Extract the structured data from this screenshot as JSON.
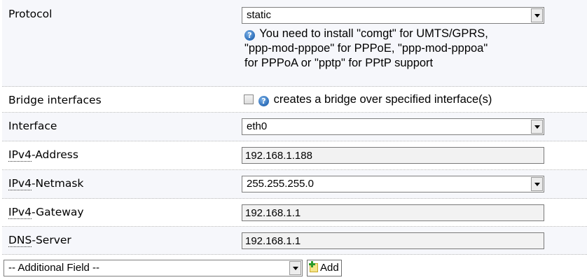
{
  "protocol": {
    "label": "Protocol",
    "selected": "static",
    "help_lines": [
      "You need to install \"comgt\" for UMTS/GPRS,",
      "\"ppp-mod-pppoe\" for PPPoE, \"ppp-mod-pppoa\"",
      "for PPPoA or \"pptp\" for PPtP support"
    ]
  },
  "bridge": {
    "label": "Bridge interfaces",
    "help": "creates a bridge over specified interface(s)"
  },
  "interface": {
    "label": "Interface",
    "selected": "eth0"
  },
  "ipv4_address": {
    "abbr": "IPv4",
    "rest": "-Address",
    "value": "192.168.1.188"
  },
  "ipv4_netmask": {
    "abbr": "IPv4",
    "rest": "-Netmask",
    "selected": "255.255.255.0"
  },
  "ipv4_gateway": {
    "abbr": "IPv4",
    "rest": "-Gateway",
    "value": "192.168.1.1"
  },
  "dns_server": {
    "abbr": "DNS",
    "rest": "-Server",
    "value": "192.168.1.1"
  },
  "additional": {
    "selected": "-- Additional Field --",
    "add_label": "Add"
  },
  "icons": {
    "help": "question-mark-icon",
    "add": "add-document-icon"
  },
  "colors": {
    "row_alt_background": "#f6f7fb",
    "help_icon": "#2a6cb8",
    "readonly_input": "#f2f2f2"
  }
}
